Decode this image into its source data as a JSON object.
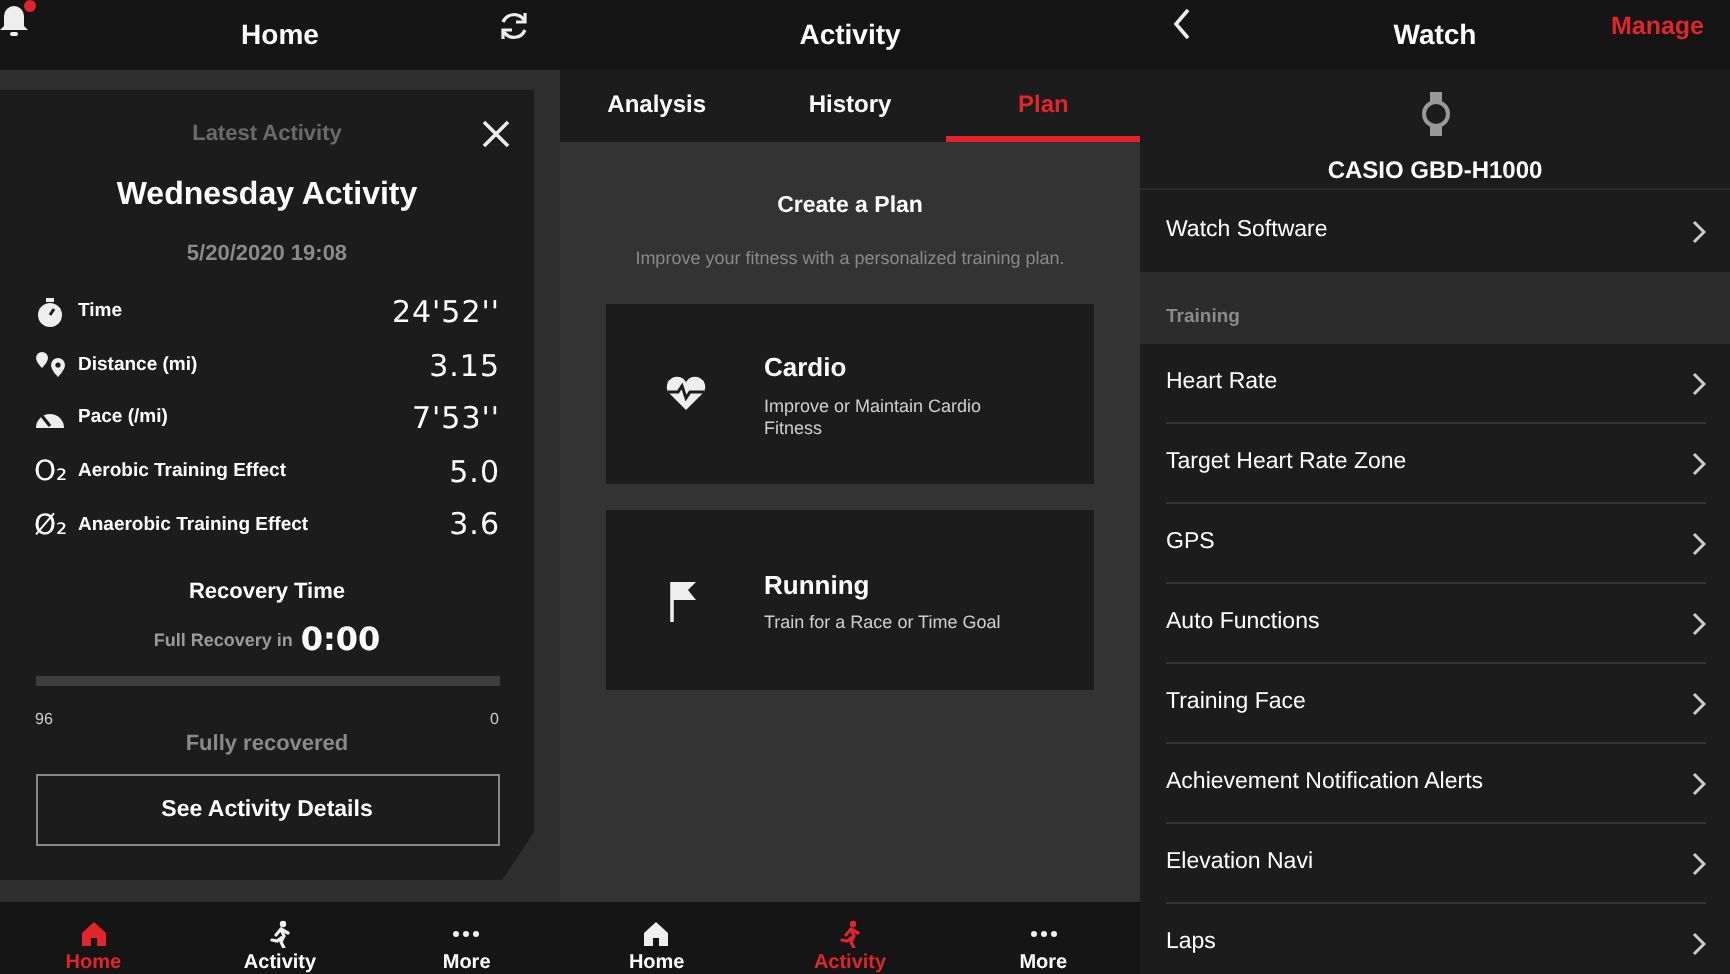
{
  "home": {
    "header": {
      "title": "Home",
      "has_notification": true
    },
    "card": {
      "eyebrow": "Latest Activity",
      "title": "Wednesday Activity",
      "date": "5/20/2020 19:08",
      "metrics": [
        {
          "kind": "stopwatch",
          "label": "Time",
          "value": "24'52''"
        },
        {
          "kind": "pins",
          "label": "Distance (mi)",
          "value": "3.15"
        },
        {
          "kind": "pace",
          "label": "Pace (/mi)",
          "value": "7'53''"
        },
        {
          "kind": "symbol",
          "symbol": "O₂",
          "label": "Aerobic Training Effect",
          "value": "5.0"
        },
        {
          "kind": "symbol",
          "symbol": "Ø₂",
          "label": "Anaerobic Training Effect",
          "value": "3.6"
        }
      ],
      "recovery": {
        "title": "Recovery Time",
        "caption": "Full Recovery in",
        "time": "0:00",
        "min_label": "96",
        "max_label": "0",
        "status": "Fully recovered"
      },
      "button": "See Activity Details"
    },
    "nav": [
      {
        "kind": "home",
        "label": "Home",
        "selected": true
      },
      {
        "kind": "activity",
        "label": "Activity",
        "selected": false
      },
      {
        "kind": "more",
        "label": "More",
        "selected": false
      }
    ]
  },
  "activity": {
    "header": {
      "title": "Activity"
    },
    "tabs": [
      {
        "label": "Analysis",
        "selected": false
      },
      {
        "label": "History",
        "selected": false
      },
      {
        "label": "Plan",
        "selected": true
      }
    ],
    "heading": "Create a Plan",
    "subtitle": "Improve your fitness with a personalized training plan.",
    "plans": [
      {
        "kind": "heart",
        "title": "Cardio",
        "description": "Improve or Maintain Cardio Fitness"
      },
      {
        "kind": "flag",
        "title": "Running",
        "description": "Train for a Race or Time Goal"
      }
    ],
    "nav": [
      {
        "kind": "home",
        "label": "Home",
        "selected": false
      },
      {
        "kind": "activity",
        "label": "Activity",
        "selected": true
      },
      {
        "kind": "more",
        "label": "More",
        "selected": false
      }
    ]
  },
  "watch": {
    "header": {
      "title": "Watch",
      "action": "Manage"
    },
    "device": "CASIO GBD-H1000",
    "software_item": "Watch Software",
    "section": "Training",
    "items": [
      "Heart Rate",
      "Target Heart Rate Zone",
      "GPS",
      "Auto Functions",
      "Training Face",
      "Achievement Notification Alerts",
      "Elevation Navi",
      "Laps"
    ]
  }
}
